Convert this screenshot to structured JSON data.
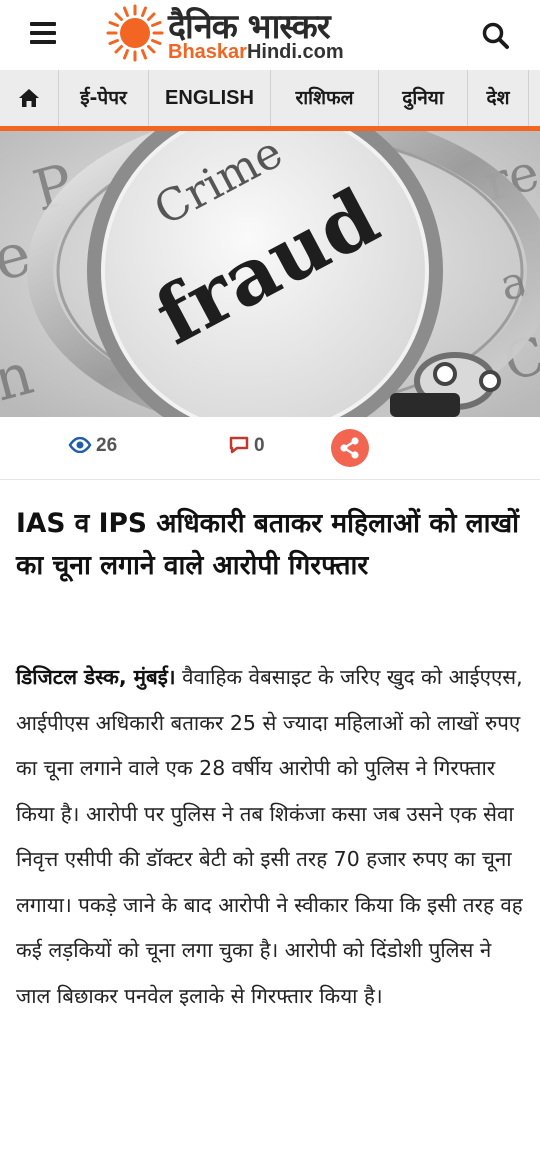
{
  "header": {
    "menu_icon": "hamburger-menu-icon",
    "logo_hindi": "दैनिक भास्कर",
    "logo_eng_accent": "Bhaskar",
    "logo_eng_rest": "Hindi.com",
    "search_icon": "search-icon",
    "brand_color": "#f26522"
  },
  "nav": {
    "home_icon": "home-icon",
    "items": [
      {
        "label": "ई-पेपर"
      },
      {
        "label": "ENGLISH"
      },
      {
        "label": "राशिफल"
      },
      {
        "label": "दुनिया"
      },
      {
        "label": "देश"
      }
    ]
  },
  "hero": {
    "image_text_1": "Crime",
    "image_text_2": "fraud"
  },
  "stats": {
    "views_icon": "eye-icon",
    "views": "26",
    "comments_icon": "comment-icon",
    "comments": "0",
    "share_icon": "share-icon"
  },
  "article": {
    "title": "IAS व IPS अधिकारी बताकर महिलाओं को लाखों का चूना लगाने वाले आरोपी गिरफ्तार",
    "dateline": "डिजिटल डेस्क, मुंबई।",
    "body": "वैवाहिक वेबसाइट के जरिए खुद को आईएएस, आईपीएस अधिकारी बताकर 25 से ज्यादा महिलाओं को लाखों रुपए का चूना लगाने वाले एक 28 वर्षीय आरोपी को पुलिस ने गिरफ्तार किया है। आरोपी पर पुलिस ने तब शिकंजा कसा जब उसने एक सेवा निवृत्त एसीपी की डॉक्टर बेटी को इसी तरह 70 हजार रुपए का चूना लगाया। पकड़े जाने के बाद आरोपी ने स्वीकार किया कि इसी तरह वह कई लड़कियों को चूना लगा चुका है। आरोपी को दिंडोशी पुलिस ने जाल बिछाकर पनवेल इलाके से गिरफ्तार किया है।"
  }
}
